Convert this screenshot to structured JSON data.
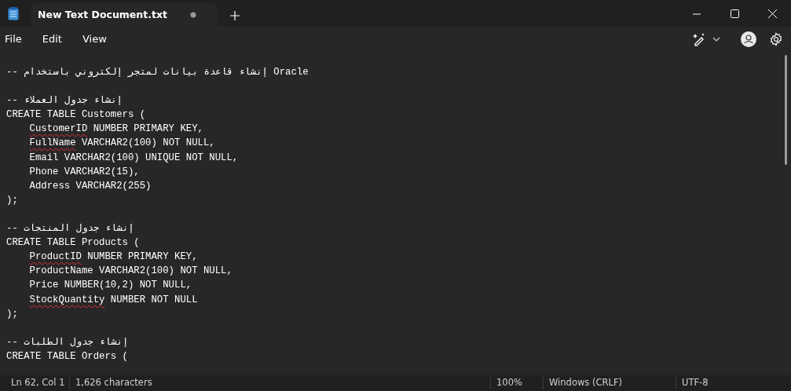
{
  "tabs": [
    {
      "title": "New Text Document.txt",
      "selected": true,
      "unsaved": true
    }
  ],
  "menu": [
    "File",
    "Edit",
    "View"
  ],
  "editor": {
    "lines": [
      {
        "kind": "code",
        "indented": false,
        "segments": [
          {
            "text": "-- إنشاء قاعدة بيانات لمتجر إلكتروني باستخدام Oracle",
            "misspelled": false
          }
        ]
      },
      {
        "kind": "blank"
      },
      {
        "kind": "code",
        "indented": false,
        "segments": [
          {
            "text": "-- إنشاء جدول العملاء",
            "misspelled": false
          }
        ]
      },
      {
        "kind": "code",
        "indented": false,
        "segments": [
          {
            "text": "CREATE TABLE Customers (",
            "misspelled": false
          }
        ]
      },
      {
        "kind": "code",
        "indented": true,
        "segments": [
          {
            "text": "CustomerID",
            "misspelled": true
          },
          {
            "text": " NUMBER PRIMARY KEY,",
            "misspelled": false
          }
        ]
      },
      {
        "kind": "code",
        "indented": true,
        "segments": [
          {
            "text": "FullName",
            "misspelled": true
          },
          {
            "text": " VARCHAR2(100) NOT NULL,",
            "misspelled": false
          }
        ]
      },
      {
        "kind": "code",
        "indented": true,
        "segments": [
          {
            "text": "Email VARCHAR2(100) UNIQUE NOT NULL,",
            "misspelled": false
          }
        ]
      },
      {
        "kind": "code",
        "indented": true,
        "segments": [
          {
            "text": "Phone VARCHAR2(15),",
            "misspelled": false
          }
        ]
      },
      {
        "kind": "code",
        "indented": true,
        "segments": [
          {
            "text": "Address VARCHAR2(255)",
            "misspelled": false
          }
        ]
      },
      {
        "kind": "code",
        "indented": false,
        "segments": [
          {
            "text": ");",
            "misspelled": false
          }
        ]
      },
      {
        "kind": "blank"
      },
      {
        "kind": "code",
        "indented": false,
        "segments": [
          {
            "text": "-- إنشاء جدول المنتجات",
            "misspelled": false
          }
        ]
      },
      {
        "kind": "code",
        "indented": false,
        "segments": [
          {
            "text": "CREATE TABLE Products (",
            "misspelled": false
          }
        ]
      },
      {
        "kind": "code",
        "indented": true,
        "segments": [
          {
            "text": "ProductID",
            "misspelled": true
          },
          {
            "text": " NUMBER PRIMARY KEY,",
            "misspelled": false
          }
        ]
      },
      {
        "kind": "code",
        "indented": true,
        "segments": [
          {
            "text": "ProductName VARCHAR2(100) NOT NULL,",
            "misspelled": false
          }
        ]
      },
      {
        "kind": "code",
        "indented": true,
        "segments": [
          {
            "text": "Price NUMBER(10,2) NOT NULL,",
            "misspelled": false
          }
        ]
      },
      {
        "kind": "code",
        "indented": true,
        "segments": [
          {
            "text": "StockQuantity",
            "misspelled": true
          },
          {
            "text": " NUMBER NOT NULL",
            "misspelled": false
          }
        ]
      },
      {
        "kind": "code",
        "indented": false,
        "segments": [
          {
            "text": ");",
            "misspelled": false
          }
        ]
      },
      {
        "kind": "blank"
      },
      {
        "kind": "code",
        "indented": false,
        "segments": [
          {
            "text": "-- إنشاء جدول الطلبات",
            "misspelled": false
          }
        ]
      },
      {
        "kind": "code",
        "indented": false,
        "segments": [
          {
            "text": "CREATE TABLE Orders (",
            "misspelled": false
          }
        ]
      }
    ]
  },
  "status_bar": {
    "position": "Ln 62, Col 1",
    "characters": "1,626 characters",
    "zoom": "100%",
    "line_ending": "Windows (CRLF)",
    "encoding": "UTF-8"
  }
}
